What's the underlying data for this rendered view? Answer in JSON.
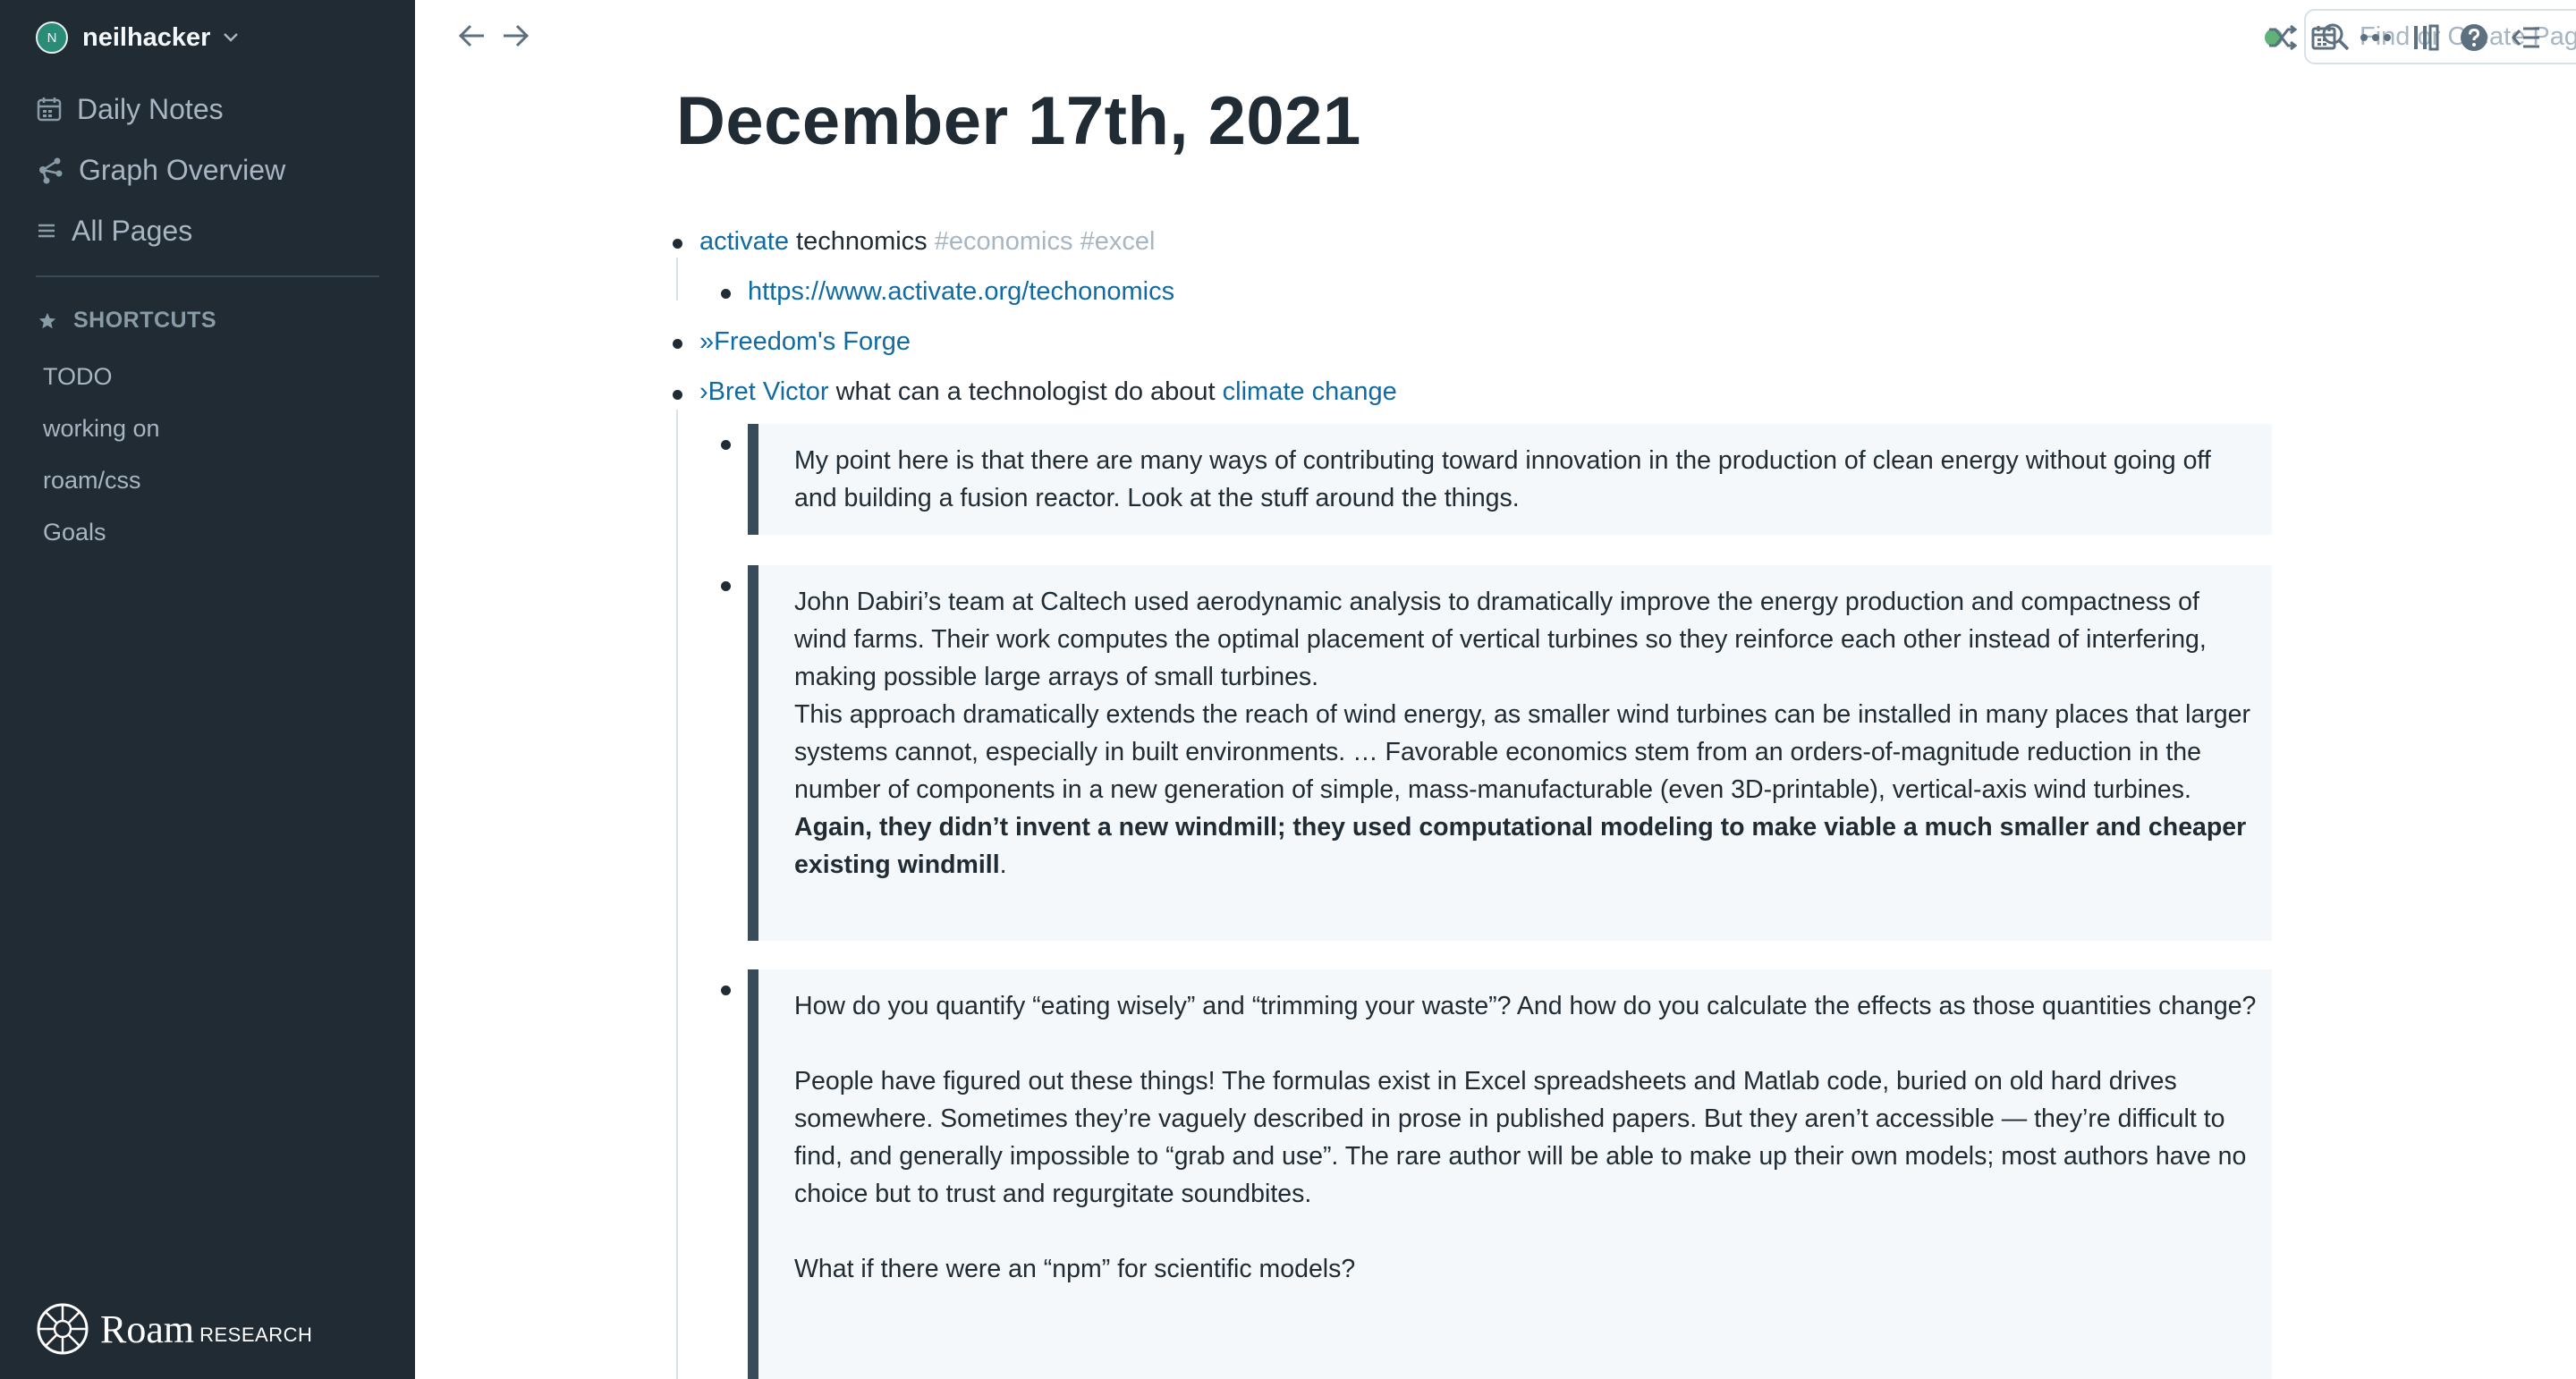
{
  "sidebar": {
    "user": {
      "initial": "N",
      "name": "neilhacker"
    },
    "nav": [
      {
        "label": "Daily Notes",
        "icon": "calendar-icon"
      },
      {
        "label": "Graph Overview",
        "icon": "graph-icon"
      },
      {
        "label": "All Pages",
        "icon": "list-icon"
      }
    ],
    "shortcuts_label": "SHORTCUTS",
    "shortcuts": [
      "TODO",
      "working on",
      "roam/css",
      "Goals"
    ],
    "brand": {
      "name": "Roam",
      "sub": "RESEARCH"
    }
  },
  "topbar": {
    "search_placeholder": "Find or Create Page",
    "sync_color": "#5fb37a"
  },
  "page": {
    "title": "December 17th, 2021",
    "blocks": {
      "b1": {
        "link": "activate",
        "text": " technomics ",
        "tag1": "#economics",
        "tag2": "#excel"
      },
      "b1_child": {
        "url": "https://www.activate.org/techonomics"
      },
      "b2": {
        "link": "»Freedom's Forge"
      },
      "b3": {
        "link1": "›Bret Victor",
        "text": " what can a technologist do about ",
        "link2": "climate change"
      },
      "q1": "My point here is that there are many ways of contributing toward innovation in the production of clean energy without going off and building a fusion reactor. Look at the stuff around the things.",
      "q2": {
        "p1": "John Dabiri’s team at Caltech used aerodynamic analysis to dramatically improve the energy production and compactness of wind farms. Their work computes the optimal placement of vertical turbines so they reinforce each other instead of interfering, making possible large arrays of small turbines.",
        "p2": "This approach dramatically extends the reach of wind energy, as smaller wind turbines can be installed in many places that larger systems cannot, especially in built environments. … Favorable economics stem from an orders-of-magnitude reduction in the number of components in a new generation of simple, mass-manufacturable (even 3D-printable), vertical-axis wind turbines.",
        "bold": "Again, they didn’t invent a new windmill; they used computational modeling to make viable a much smaller and cheaper existing windmill",
        "end": "."
      },
      "q3": {
        "p1": "How do you quantify “eating wisely” and “trimming your waste”? And how do you calculate the effects as those quantities change?",
        "p2": "People have figured out these things! The formulas exist in Excel spreadsheets and Matlab code, buried on old hard drives somewhere. Sometimes they’re vaguely described in prose in published papers. But they aren’t accessible — they’re difficult to find, and generally impossible to “grab and use”. The rare author will be able to make up their own models; most authors have no choice but to trust and regurgitate soundbites.",
        "p3": "What if there were an “npm” for scientific models?"
      }
    }
  }
}
